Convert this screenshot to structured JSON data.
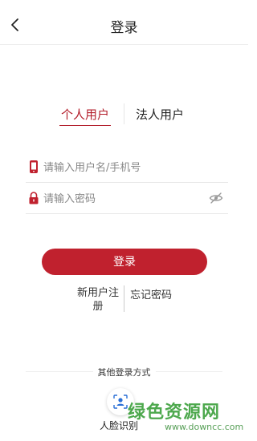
{
  "header": {
    "title": "登录",
    "back_icon": "back-arrow-icon"
  },
  "tabs": [
    {
      "label": "个人用户",
      "active": true
    },
    {
      "label": "法人用户",
      "active": false
    }
  ],
  "form": {
    "username": {
      "placeholder": "请输入用户名/手机号",
      "value": "",
      "icon": "phone-icon"
    },
    "password": {
      "placeholder": "请输入密码",
      "value": "",
      "icon": "lock-icon",
      "toggle_icon": "eye-hidden-icon"
    }
  },
  "actions": {
    "login_label": "登录",
    "register_label": "新用户注册",
    "forgot_label": "忘记密码"
  },
  "other_login": {
    "title": "其他登录方式",
    "face_label": "人脸识别",
    "face_icon": "face-scan-icon"
  },
  "watermark": {
    "brand": "绿色资源网",
    "site": "www.downcc.com"
  },
  "colors": {
    "accent": "#c0212e",
    "tab_active": "#b31e2b",
    "watermark": "#2e9a2e"
  }
}
